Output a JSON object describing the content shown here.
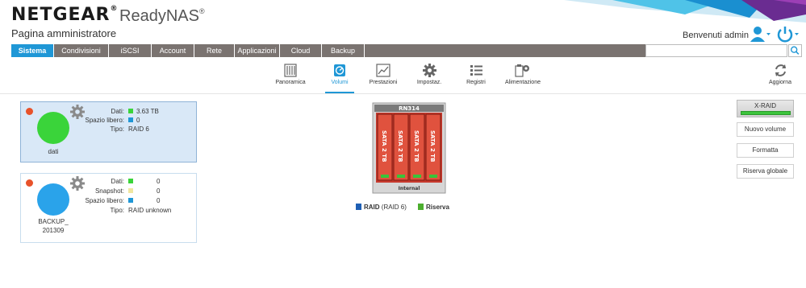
{
  "header": {
    "brand": "NETGEAR",
    "product": "ReadyNAS",
    "page_title": "Pagina amministratore",
    "welcome": "Benvenuti admin",
    "reg_mark": "®"
  },
  "nav": {
    "tabs": [
      {
        "label": "Sistema",
        "active": true
      },
      {
        "label": "Condivisioni"
      },
      {
        "label": "iSCSI"
      },
      {
        "label": "Account"
      },
      {
        "label": "Rete"
      },
      {
        "label": "Applicazioni"
      },
      {
        "label": "Cloud"
      },
      {
        "label": "Backup"
      }
    ],
    "search_value": ""
  },
  "toolbar": {
    "items": [
      {
        "label": "Panoramica",
        "icon": "overview-icon"
      },
      {
        "label": "Volumi",
        "icon": "volumes-icon",
        "active": true
      },
      {
        "label": "Prestazioni",
        "icon": "performance-icon"
      },
      {
        "label": "Impostaz.",
        "icon": "settings-gear-icon"
      },
      {
        "label": "Registri",
        "icon": "logs-list-icon"
      },
      {
        "label": "Alimentazione",
        "icon": "power-settings-icon"
      }
    ],
    "refresh_label": "Aggiorna"
  },
  "volumes": [
    {
      "name": "dati",
      "color": "#3ad43a",
      "rows": [
        {
          "label": "Dati:",
          "swatch": "#3ad43a",
          "value": "3.63 TB"
        },
        {
          "label": "Spazio libero:",
          "swatch": "#1f97d6",
          "value": "0"
        },
        {
          "label": "Tipo:",
          "value": "RAID 6"
        }
      ]
    },
    {
      "name_line1": "BACKUP_",
      "name_line2": "201309",
      "color": "#2aa3ea",
      "rows": [
        {
          "label": "Dati:",
          "swatch": "#3ad43a",
          "value": "0"
        },
        {
          "label": "Snapshot:",
          "swatch": "#f0e6a0",
          "value": "0"
        },
        {
          "label": "Spazio libero:",
          "swatch": "#1f97d6",
          "value": "0"
        },
        {
          "label": "Tipo:",
          "value": "RAID unknown"
        }
      ]
    }
  ],
  "nas": {
    "model": "RN314",
    "bay_label": "SATA 2 TB",
    "footer": "Internal"
  },
  "legend": {
    "raid_label": "RAID",
    "raid_type": "(RAID 6)",
    "raid_color": "#1e5fb4",
    "spare_label": "Riserva",
    "spare_color": "#4cae2e"
  },
  "actions": {
    "xraid": "X-RAID",
    "new_volume": "Nuovo volume",
    "format": "Formatta",
    "global_spare": "Riserva globale"
  }
}
